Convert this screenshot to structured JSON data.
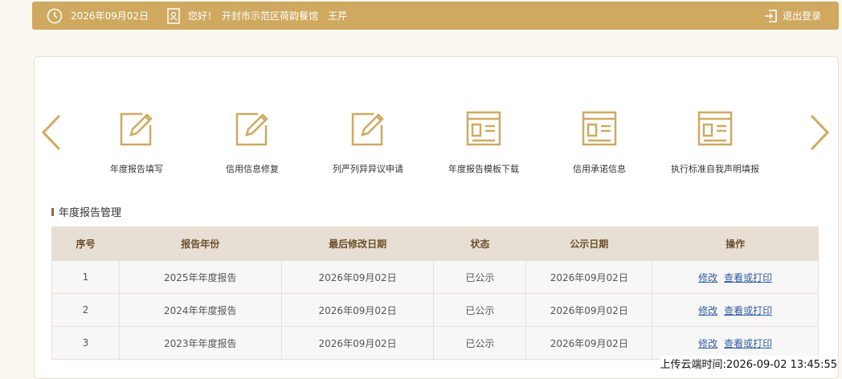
{
  "topbar": {
    "date": "2026年09月02日",
    "greeting": "您好！",
    "org": "开封市示范区荷韵餐馆",
    "user": "王芹",
    "logout_label": "退出登录"
  },
  "functions": [
    {
      "label": "年度报告填写",
      "icon": "edit-icon"
    },
    {
      "label": "信用信息修复",
      "icon": "edit-icon"
    },
    {
      "label": "列严列异异议申请",
      "icon": "edit-icon"
    },
    {
      "label": "年度报告模板下载",
      "icon": "document-icon"
    },
    {
      "label": "信用承诺信息",
      "icon": "document-icon"
    },
    {
      "label": "执行标准自我声明填报",
      "icon": "document-icon"
    }
  ],
  "section_title": "年度报告管理",
  "table": {
    "headers": [
      "序号",
      "报告年份",
      "最后修改日期",
      "状态",
      "公示日期",
      "操作"
    ],
    "rows": [
      {
        "no": "1",
        "year": "2025年年度报告",
        "modified": "2026年09月02日",
        "status": "已公示",
        "publish": "2026年09月02日"
      },
      {
        "no": "2",
        "year": "2024年年度报告",
        "modified": "2026年09月02日",
        "status": "已公示",
        "publish": "2026年09月02日"
      },
      {
        "no": "3",
        "year": "2023年年度报告",
        "modified": "2026年09月02日",
        "status": "已公示",
        "publish": "2026年09月02日"
      }
    ],
    "action_edit": "修改",
    "action_view": "查看或打印"
  },
  "upload_time": "上传云端时间:2026-09-02 13:45:55",
  "colors": {
    "accent": "#cfa960",
    "header_bg": "#e8dfd4",
    "link": "#2e5d9f"
  }
}
